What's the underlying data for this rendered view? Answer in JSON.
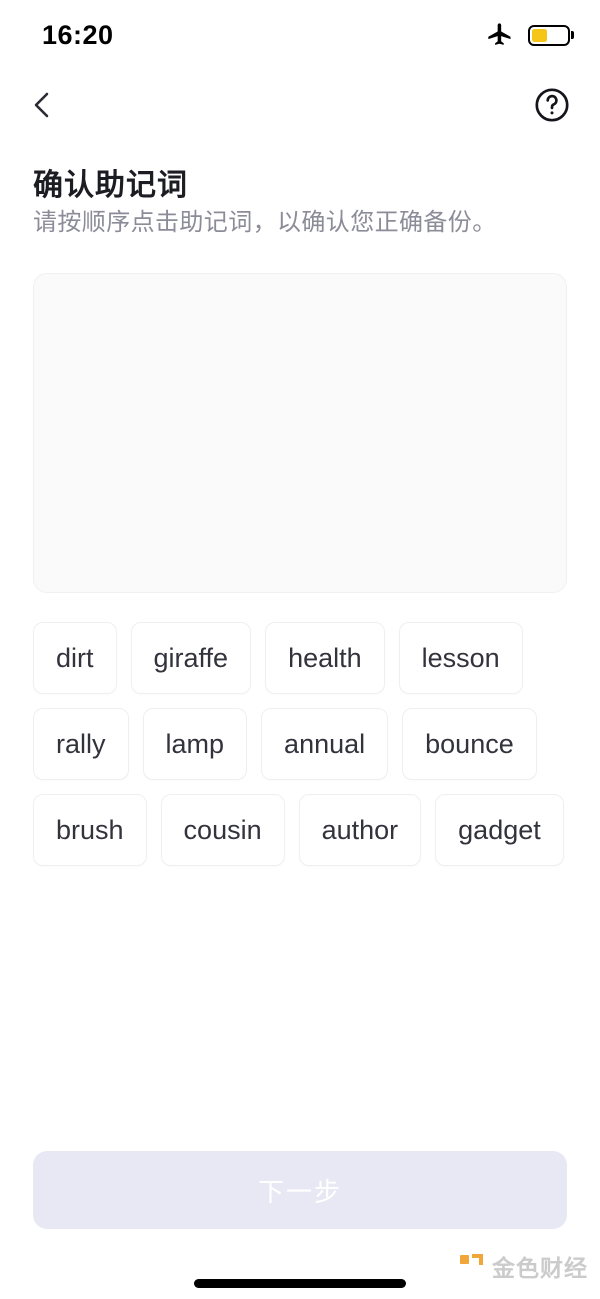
{
  "status_bar": {
    "time": "16:20",
    "airplane_icon": "airplane-mode-icon",
    "battery_icon": "battery-icon",
    "battery_level_percent": 45,
    "battery_color": "#f5c518"
  },
  "nav_bar": {
    "back_icon": "chevron-left-icon",
    "help_icon": "question-mark-circle-icon"
  },
  "header": {
    "title": "确认助记词",
    "subtitle": "请按顺序点击助记词，以确认您正确备份。",
    "title_color": "#1c1c23",
    "subtitle_color": "#8c8c99"
  },
  "answer_box": {
    "selected_words": [],
    "background_color": "#fafafa",
    "border_color": "#f0f0f2"
  },
  "word_pool": {
    "words": [
      "dirt",
      "giraffe",
      "health",
      "lesson",
      "rally",
      "lamp",
      "annual",
      "bounce",
      "brush",
      "cousin",
      "author",
      "gadget"
    ],
    "chip_background": "#ffffff",
    "chip_border": "#efeff1",
    "chip_text_color": "#33333d"
  },
  "footer": {
    "next_button_label": "下一步",
    "next_button_disabled": true,
    "next_button_color": "#e8e8f4",
    "next_button_text_color": "#ffffff"
  },
  "watermark": {
    "text": "金色财经",
    "logo_color": "#f0a22e",
    "text_color": "#c9c9c9"
  }
}
